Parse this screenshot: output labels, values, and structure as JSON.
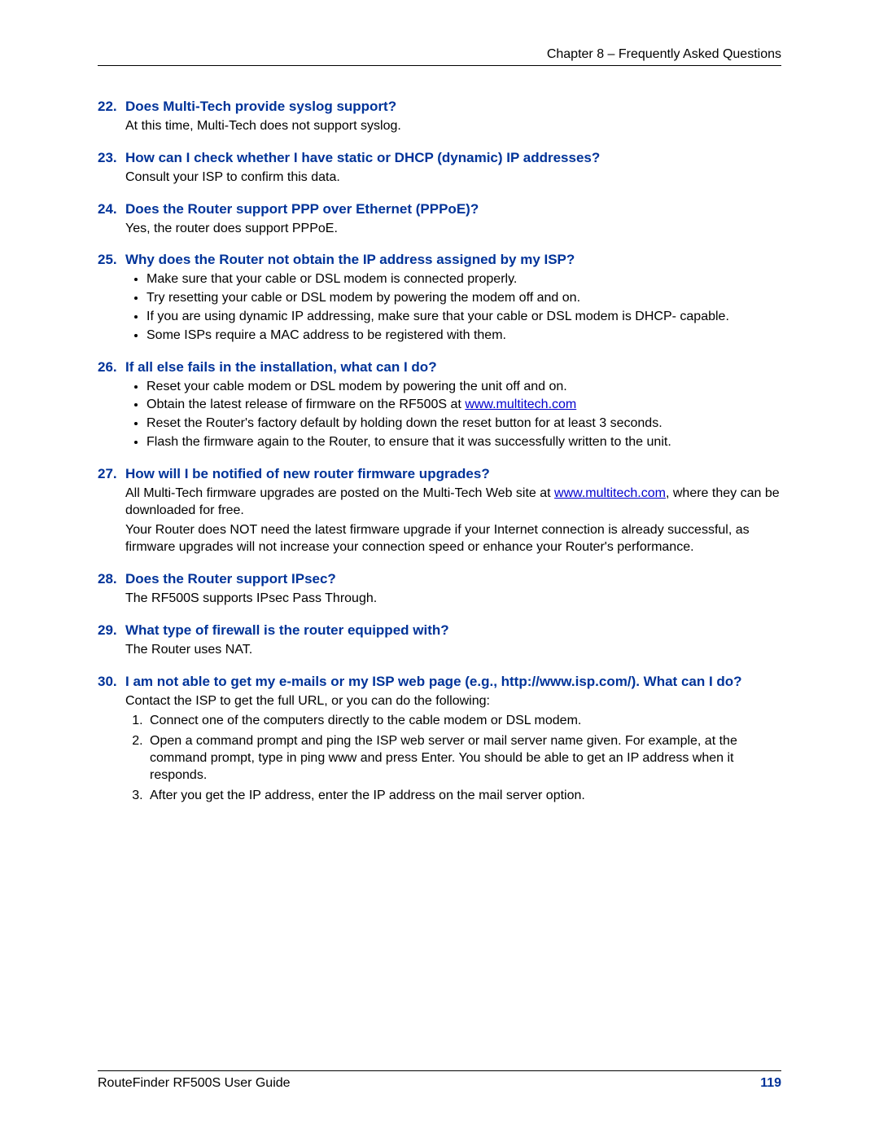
{
  "header": {
    "chapter": "Chapter 8 – Frequently Asked Questions"
  },
  "faq": [
    {
      "num": "22.",
      "q": "Does Multi-Tech  provide syslog support?",
      "a": [
        "At this time, Multi-Tech does not support syslog."
      ]
    },
    {
      "num": "23.",
      "q": "How can I check whether I have static or DHCP (dynamic) IP addresses?",
      "a": [
        "Consult your ISP to confirm this data."
      ]
    },
    {
      "num": "24.",
      "q": "Does the Router support PPP over Ethernet (PPPoE)?",
      "a": [
        "Yes, the router does support PPPoE."
      ]
    },
    {
      "num": "25.",
      "q": "Why does the Router not obtain the IP address assigned by my ISP?",
      "bullets": [
        "Make sure that your cable or DSL modem is connected properly.",
        "Try resetting your cable or DSL modem by powering the modem off and on.",
        "If you are using dynamic IP addressing, make sure that your cable or DSL modem is DHCP- capable.",
        "Some ISPs require a MAC address to be registered with them."
      ]
    },
    {
      "num": "26.",
      "q": "If all else fails in the installation, what can I do?",
      "bullets": [
        "Reset your cable modem or DSL modem by powering the unit off and on.",
        {
          "pre": "Obtain the latest release of firmware on the RF500S at ",
          "link": "www.multitech.com",
          "post": ""
        },
        "Reset the Router's factory default by holding down the reset button for at least 3 seconds.",
        "Flash the firmware again to the Router, to ensure that it was successfully written to the unit."
      ]
    },
    {
      "num": "27.",
      "q": "How will I be notified of new router firmware upgrades?",
      "a": [
        {
          "pre": "All Multi-Tech firmware upgrades are posted on the Multi-Tech Web site at ",
          "link": "www.multitech.com",
          "post": ", where they can be downloaded for free."
        },
        "Your Router does NOT need the latest firmware upgrade if your Internet connection is already successful, as firmware upgrades will not increase your connection speed or enhance your Router's performance."
      ]
    },
    {
      "num": "28.",
      "q": "Does the Router support IPsec?",
      "a": [
        "The RF500S supports IPsec Pass Through."
      ]
    },
    {
      "num": "29.",
      "q": "What type of firewall is the router equipped with?",
      "a": [
        "The Router uses NAT."
      ]
    },
    {
      "num": "30.",
      "q": "I am not able to get my e-mails or my ISP web page (e.g., http://www.isp.com/). What can I do?",
      "a": [
        "Contact the ISP to get the full URL, or you can do the following:"
      ],
      "steps": [
        "Connect one of the computers directly to the cable modem or DSL modem.",
        "Open a command prompt and ping the ISP web server or mail server name given. For example, at the command prompt, type in ping www and press Enter. You should be able to get an IP address when it responds.",
        "After you get the IP address, enter the IP address on the mail server option."
      ]
    }
  ],
  "footer": {
    "guide": "RouteFinder RF500S User Guide",
    "page": "119"
  }
}
